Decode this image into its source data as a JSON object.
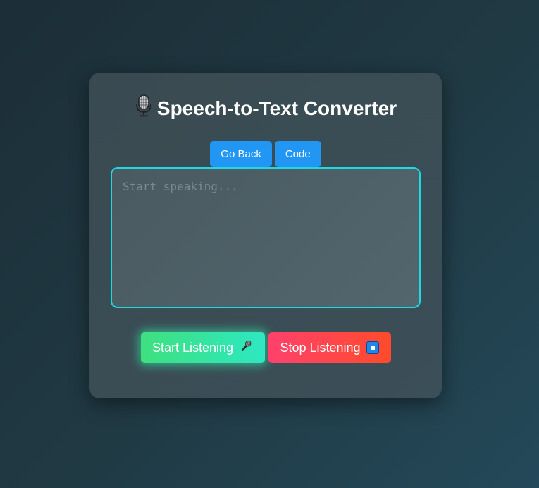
{
  "app": {
    "title": "Speech-to-Text Converter"
  },
  "nav": {
    "go_back_label": "Go Back",
    "code_label": "Code"
  },
  "transcript": {
    "value": "",
    "placeholder": "Start speaking..."
  },
  "actions": {
    "start_label": "Start Listening",
    "stop_label": "Stop Listening"
  },
  "icons": {
    "title_icon": "studio-microphone-icon",
    "start_icon": "microphone-icon",
    "stop_icon": "stop-square-icon"
  },
  "colors": {
    "nav_button": "#2196f3",
    "textarea_border": "#1fd8e6",
    "start_gradient": [
      "#3ee07e",
      "#2ee8c2"
    ],
    "stop_gradient": [
      "#ff416c",
      "#ff4b2b"
    ]
  }
}
